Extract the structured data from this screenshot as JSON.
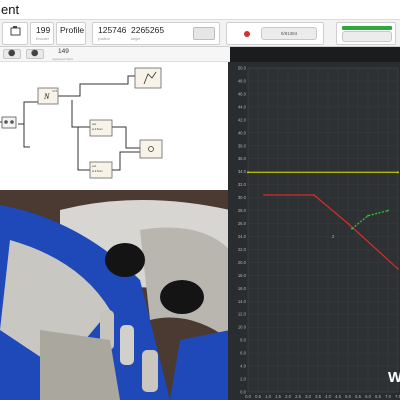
{
  "window": {
    "title": "ent"
  },
  "toolbar": {
    "count_value": "199",
    "count_caption": "Encoder",
    "profile_label": "Profile",
    "pos_a": "125746",
    "pos_b": "2265265",
    "pos_a_caption": "position",
    "pos_b_caption": "target",
    "status_text": "0/81384",
    "accent_green": "#2eaa3d",
    "record_color": "#d32f2f"
  },
  "strip": {
    "value": "149",
    "caption": "registered block"
  },
  "diagram": {
    "blocks": [
      {
        "id": "gain-block",
        "label": "N",
        "sub": "=0.5"
      },
      {
        "id": "scope-block",
        "label": ""
      },
      {
        "id": "out-block-1",
        "label": "out",
        "sub": "te 4.5mm"
      },
      {
        "id": "out-block-2",
        "label": "out",
        "sub": "te 4.5mm"
      },
      {
        "id": "sum-block",
        "label": ""
      }
    ]
  },
  "chart_data": {
    "type": "line",
    "title": "",
    "xlabel": "",
    "ylabel": "",
    "ylim": [
      0,
      50
    ],
    "y_ticks": [
      "0.0",
      "2.0",
      "4.0",
      "6.0",
      "8.0",
      "10.0",
      "12.0",
      "14.0",
      "16.0",
      "18.0",
      "20.0",
      "22.0",
      "24.0",
      "26.0",
      "28.0",
      "30.0",
      "32.0",
      "34.0",
      "36.0",
      "38.0",
      "40.0",
      "42.0",
      "44.0",
      "46.0",
      "48.0",
      "50.0"
    ],
    "x_ticks": [
      "0.0",
      "0.5",
      "1.0",
      "1.5",
      "2.0",
      "2.5",
      "3.0",
      "3.5",
      "4.0",
      "4.5",
      "5.0",
      "5.5",
      "6.0",
      "6.5",
      "7.0",
      "7.5"
    ],
    "series": [
      {
        "color": "#e0e000",
        "x": [
          0,
          7.5
        ],
        "y": [
          33.9,
          33.9
        ]
      },
      {
        "color": "#d62c2c",
        "x": [
          0.8,
          3.3,
          5.0,
          7.5
        ],
        "y": [
          30.4,
          30.4,
          26.0,
          19.0
        ]
      },
      {
        "color": "#2ecc40",
        "x": [
          5.2,
          6.0,
          7.0
        ],
        "y": [
          25.2,
          27.2,
          28.0
        ]
      }
    ],
    "annotations": [
      "2"
    ],
    "grid": true
  },
  "watermark": "W"
}
